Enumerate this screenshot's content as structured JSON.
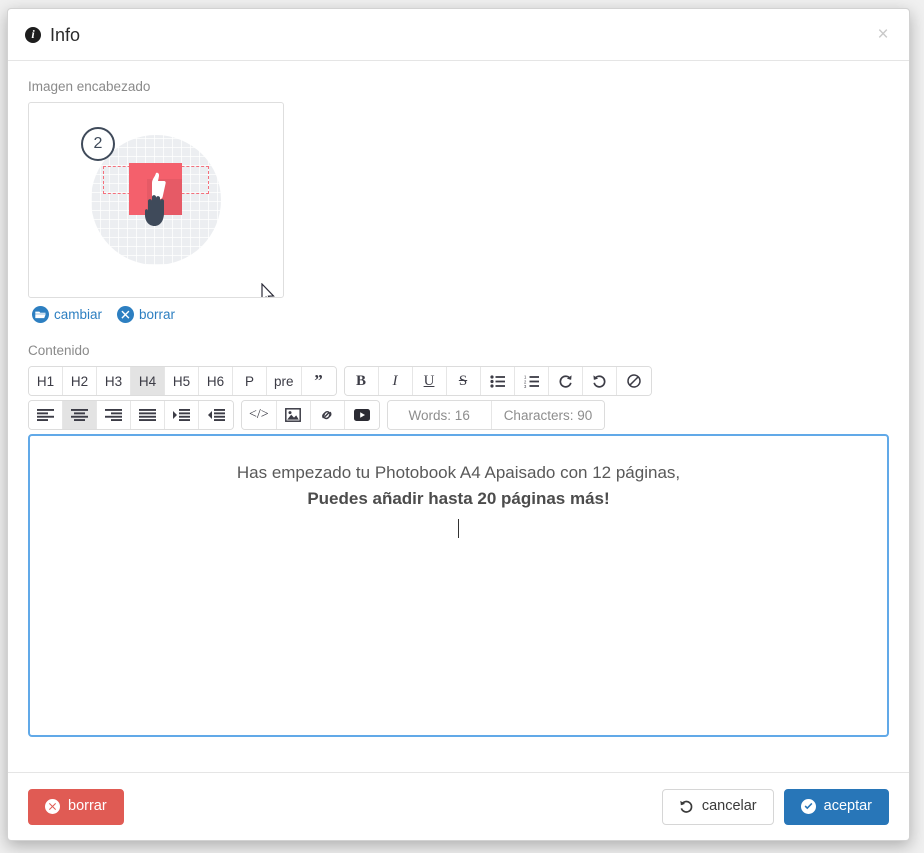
{
  "dialog": {
    "title": "Info",
    "info_icon": "info-circle-icon",
    "close_label": "×"
  },
  "image_section": {
    "label": "Imagen encabezado",
    "illustration": {
      "step_number": "2",
      "alt": "tutorial-step-2-thumbs-up-drag"
    },
    "actions": [
      {
        "label": "cambiar",
        "icon": "folder-open-icon"
      },
      {
        "label": "borrar",
        "icon": "times-circle-icon"
      }
    ]
  },
  "content_section": {
    "label": "Contenido",
    "toolbar_row1": [
      {
        "label": "H1",
        "name": "heading-1-button",
        "active": false
      },
      {
        "label": "H2",
        "name": "heading-2-button",
        "active": false
      },
      {
        "label": "H3",
        "name": "heading-3-button",
        "active": false
      },
      {
        "label": "H4",
        "name": "heading-4-button",
        "active": true
      },
      {
        "label": "H5",
        "name": "heading-5-button",
        "active": false
      },
      {
        "label": "H6",
        "name": "heading-6-button",
        "active": false
      },
      {
        "label": "P",
        "name": "paragraph-button",
        "active": false
      },
      {
        "label": "pre",
        "name": "preformatted-button",
        "active": false
      },
      {
        "label": "”",
        "name": "blockquote-button",
        "active": false
      }
    ],
    "toolbar_row1b": [
      {
        "label": "B",
        "name": "bold-button"
      },
      {
        "label": "I",
        "name": "italic-button"
      },
      {
        "label": "U",
        "name": "underline-button"
      },
      {
        "label": "S",
        "name": "strikethrough-button"
      },
      {
        "label": "unordered-list",
        "name": "unordered-list-button"
      },
      {
        "label": "ordered-list",
        "name": "ordered-list-button"
      },
      {
        "label": "redo",
        "name": "redo-button"
      },
      {
        "label": "undo",
        "name": "undo-button"
      },
      {
        "label": "clear",
        "name": "clear-formatting-button"
      }
    ],
    "toolbar_row2": [
      {
        "name": "align-left-button",
        "active": false
      },
      {
        "name": "align-center-button",
        "active": true
      },
      {
        "name": "align-right-button",
        "active": false
      },
      {
        "name": "align-justify-button",
        "active": false
      },
      {
        "name": "indent-button",
        "active": false
      },
      {
        "name": "outdent-button",
        "active": false
      }
    ],
    "toolbar_row2b": [
      {
        "name": "code-view-button",
        "label": "</>"
      },
      {
        "name": "insert-image-button",
        "label": "image"
      },
      {
        "name": "insert-link-button",
        "label": "link"
      },
      {
        "name": "insert-video-button",
        "label": "video"
      }
    ],
    "counters": {
      "words": "Words: 16",
      "characters": "Characters: 90"
    },
    "editor": {
      "line1": "Has empezado tu Photobook A4 Apaisado con 12 páginas,",
      "line2": "Puedes añadir hasta 20 páginas más!"
    }
  },
  "footer": {
    "delete_label": "borrar",
    "delete_icon": "times-circle-icon",
    "cancel_label": "cancelar",
    "cancel_icon": "undo-icon",
    "accept_label": "aceptar",
    "accept_icon": "check-circle-icon"
  },
  "colors": {
    "primary": "#2876b8",
    "danger": "#e05b54",
    "link": "#2d7fc1",
    "focus_border": "#61a9e8",
    "illustration_red": "#f4606c",
    "illustration_dark": "#3f4a5a"
  }
}
